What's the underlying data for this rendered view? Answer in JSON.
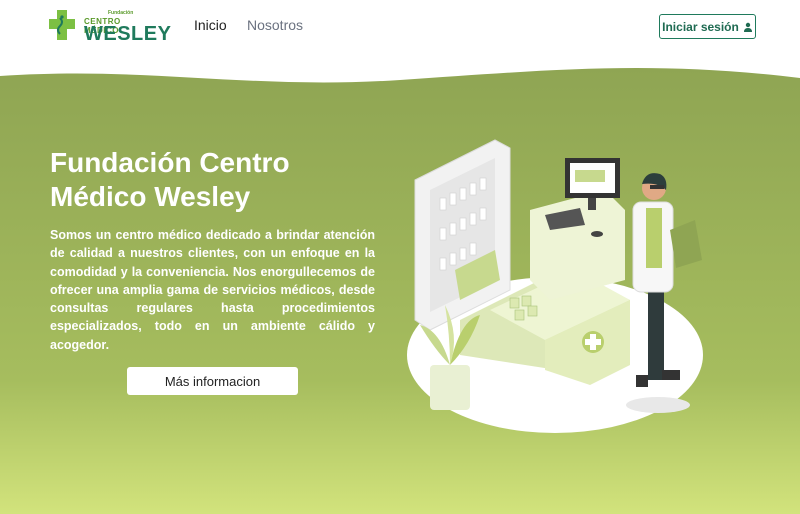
{
  "brand": {
    "small_text": "Fundación",
    "center_text": "CENTRO MÉDICO",
    "name": "WESLEY"
  },
  "nav": {
    "items": [
      {
        "label": "Inicio"
      },
      {
        "label": "Nosotros"
      }
    ],
    "login_label": "Iniciar sesión"
  },
  "hero": {
    "title": "Fundación Centro Médico Wesley",
    "description": "Somos un centro médico dedicado a brindar atención de calidad a nuestros clientes, con un enfoque en la comodidad y la conveniencia. Nos enorgullecemos de ofrecer una amplia gama de servicios médicos, desde consultas regulares hasta procedimientos especializados, todo en un ambiente cálido y acogedor.",
    "button_label": "Más informacion"
  },
  "colors": {
    "brand_green": "#1f7a5c",
    "hero_green": "#8ea44f",
    "hero_light": "#c9da7a"
  }
}
